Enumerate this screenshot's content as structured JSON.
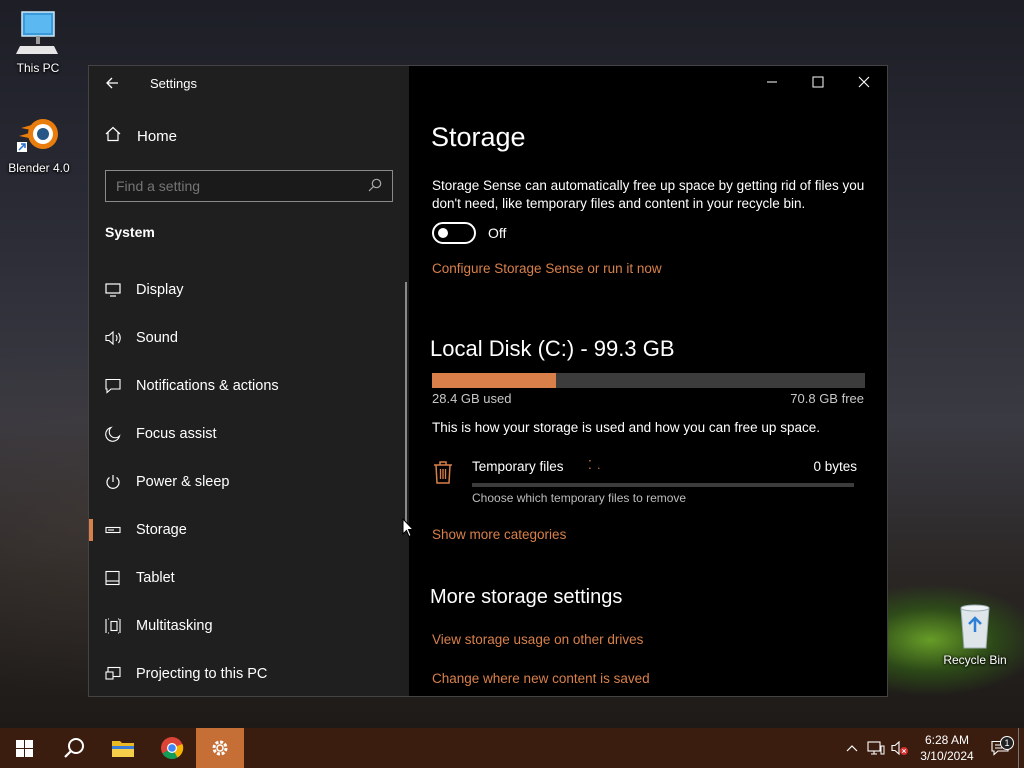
{
  "desktop": {
    "icons": [
      {
        "label": "This PC"
      },
      {
        "label": "Blender 4.0"
      },
      {
        "label": "Recycle Bin"
      }
    ]
  },
  "window": {
    "app_title": "Settings",
    "sidebar": {
      "home_label": "Home",
      "search_placeholder": "Find a setting",
      "section_title": "System",
      "items": [
        {
          "label": "Display",
          "icon": "monitor-icon"
        },
        {
          "label": "Sound",
          "icon": "speaker-icon"
        },
        {
          "label": "Notifications & actions",
          "icon": "notification-icon"
        },
        {
          "label": "Focus assist",
          "icon": "moon-icon"
        },
        {
          "label": "Power & sleep",
          "icon": "power-icon"
        },
        {
          "label": "Storage",
          "icon": "drive-icon",
          "active": true
        },
        {
          "label": "Tablet",
          "icon": "tablet-icon"
        },
        {
          "label": "Multitasking",
          "icon": "multitasking-icon"
        },
        {
          "label": "Projecting to this PC",
          "icon": "projector-icon"
        }
      ]
    },
    "content": {
      "title": "Storage",
      "storage_sense_desc": "Storage Sense can automatically free up space by getting rid of files you don't need, like temporary files and content in your recycle bin.",
      "toggle_state": "Off",
      "configure_link": "Configure Storage Sense or run it now",
      "disk_title": "Local Disk (C:) - 99.3 GB",
      "used_text": "28.4 GB used",
      "free_text": "70.8 GB free",
      "used_fraction": 0.286,
      "info_text": "This is how your storage is used and how you can free up space.",
      "category": {
        "name": "Temporary files",
        "size": "0 bytes",
        "sub": "Choose which temporary files to remove"
      },
      "show_more_link": "Show more categories",
      "more_title": "More storage settings",
      "link_other_drives": "View storage usage on other drives",
      "link_new_content": "Change where new content is saved"
    }
  },
  "taskbar": {
    "clock_time": "6:28 AM",
    "clock_date": "3/10/2024",
    "notification_count": "1"
  },
  "colors": {
    "accent": "#d9804a",
    "taskbar": "#3b1d10",
    "sidebar_bg": "#1f1f1f"
  }
}
